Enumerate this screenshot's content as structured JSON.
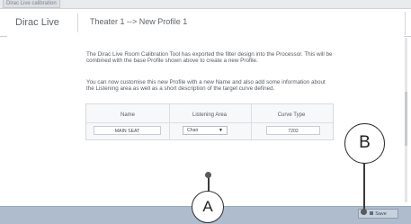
{
  "window": {
    "tab_title": "Dirac Live calibration"
  },
  "header": {
    "app_name": "Dirac Live",
    "breadcrumb": "Theater 1 --> New Profile 1"
  },
  "main": {
    "paragraph1": "The Dirac Live Room Calibration Tool has exported the filter design into the Processor. This will be combined with the base Profile shown above to create a new Profile.",
    "paragraph2": "You can now customise this new Profile with a new Name and also add some information about the Listening area as well as a short description of the target curve defined.",
    "table": {
      "headers": [
        "Name",
        "Listening Area",
        "Curve Type"
      ],
      "row": {
        "name_value": "MAIN SEAT",
        "listening_area_value": "Chair",
        "curve_type_value": "7202"
      }
    }
  },
  "footer": {
    "save_label": "Save"
  },
  "callouts": {
    "a": "A",
    "b": "B"
  }
}
